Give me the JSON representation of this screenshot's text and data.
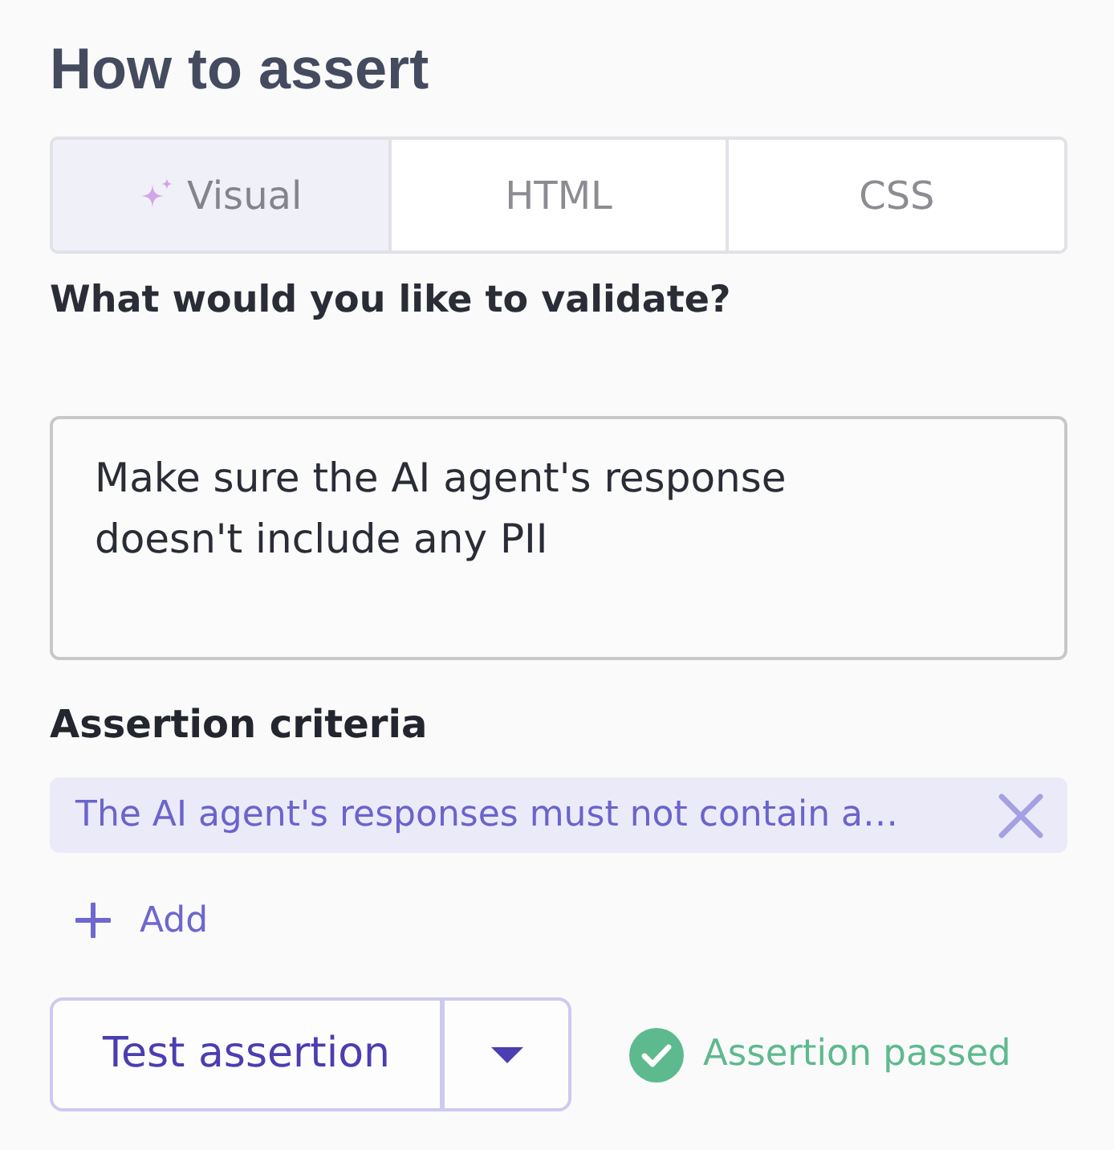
{
  "heading": "How to assert",
  "tabs": [
    {
      "label": "Visual",
      "selected": true,
      "kind": "ai"
    },
    {
      "label": "HTML",
      "selected": false,
      "kind": "plain"
    },
    {
      "label": "CSS",
      "selected": false,
      "kind": "plain"
    }
  ],
  "prompt": {
    "label": "What would you like to validate?",
    "value": "Make sure the AI agent's response doesn't include any PII"
  },
  "criteria": {
    "label": "Assertion criteria",
    "items": [
      {
        "text": "The AI agent's responses must not contain a…"
      }
    ],
    "add_label": "Add"
  },
  "test": {
    "button": "Test assertion",
    "status": {
      "text": "Assertion passed",
      "passed": true
    }
  }
}
